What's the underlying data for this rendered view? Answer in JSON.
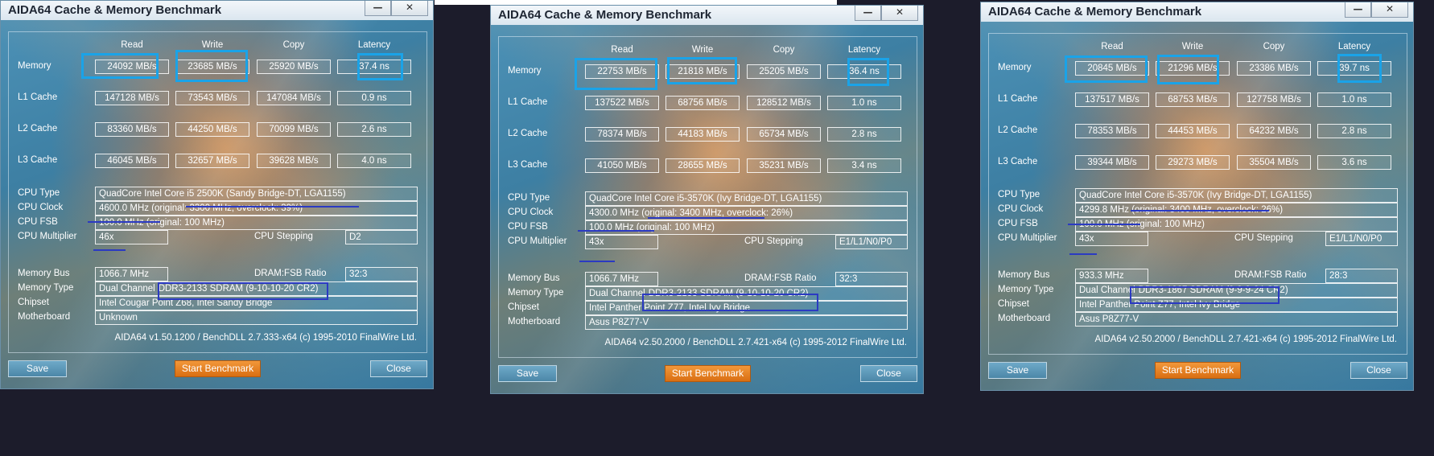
{
  "windows": [
    {
      "title": "AIDA64 Cache & Memory Benchmark",
      "headers": [
        "Read",
        "Write",
        "Copy",
        "Latency"
      ],
      "rows": [
        {
          "label": "Memory",
          "read": "24092 MB/s",
          "write": "23685 MB/s",
          "copy": "25920 MB/s",
          "latency": "37.4 ns"
        },
        {
          "label": "L1 Cache",
          "read": "147128 MB/s",
          "write": "73543 MB/s",
          "copy": "147084 MB/s",
          "latency": "0.9 ns"
        },
        {
          "label": "L2 Cache",
          "read": "83360 MB/s",
          "write": "44250 MB/s",
          "copy": "70099 MB/s",
          "latency": "2.6 ns"
        },
        {
          "label": "L3 Cache",
          "read": "46045 MB/s",
          "write": "32657 MB/s",
          "copy": "39628 MB/s",
          "latency": "4.0 ns"
        }
      ],
      "info": {
        "cpu_type_label": "CPU Type",
        "cpu_type": "QuadCore Intel Core i5 2500K  (Sandy Bridge-DT, LGA1155)",
        "cpu_clock_label": "CPU Clock",
        "cpu_clock": "4600.0 MHz  (original: 3300 MHz, overclock: 39%)",
        "cpu_fsb_label": "CPU FSB",
        "cpu_fsb": "100.0 MHz  (original: 100 MHz)",
        "cpu_mult_label": "CPU Multiplier",
        "cpu_mult": "46x",
        "cpu_step_label": "CPU Stepping",
        "cpu_step": "D2",
        "mem_bus_label": "Memory Bus",
        "mem_bus": "1066.7 MHz",
        "dram_label": "DRAM:FSB Ratio",
        "dram": "32:3",
        "mem_type_label": "Memory Type",
        "mem_type_a": "Dual Channel",
        "mem_type_b": "DDR3-2133 SDRAM  (9-10-10-20 CR2)",
        "chipset_label": "Chipset",
        "chipset": "Intel Cougar Point Z68, Intel Sandy Bridge",
        "mobo_label": "Motherboard",
        "mobo": "Unknown"
      },
      "footer": "AIDA64 v1.50.1200 / BenchDLL 2.7.333-x64  (c) 1995-2010 FinalWire Ltd.",
      "buttons": {
        "save": "Save",
        "start": "Start Benchmark",
        "close": "Close"
      }
    },
    {
      "title": "AIDA64 Cache & Memory Benchmark",
      "headers": [
        "Read",
        "Write",
        "Copy",
        "Latency"
      ],
      "rows": [
        {
          "label": "Memory",
          "read": "22753 MB/s",
          "write": "21818 MB/s",
          "copy": "25205 MB/s",
          "latency": "36.4 ns"
        },
        {
          "label": "L1 Cache",
          "read": "137522 MB/s",
          "write": "68756 MB/s",
          "copy": "128512 MB/s",
          "latency": "1.0 ns"
        },
        {
          "label": "L2 Cache",
          "read": "78374 MB/s",
          "write": "44183 MB/s",
          "copy": "65734 MB/s",
          "latency": "2.8 ns"
        },
        {
          "label": "L3 Cache",
          "read": "41050 MB/s",
          "write": "28655 MB/s",
          "copy": "35231 MB/s",
          "latency": "3.4 ns"
        }
      ],
      "info": {
        "cpu_type_label": "CPU Type",
        "cpu_type": "QuadCore Intel Core i5-3570K  (Ivy Bridge-DT, LGA1155)",
        "cpu_clock_label": "CPU Clock",
        "cpu_clock": "4300.0 MHz  (original: 3400 MHz, overclock: 26%)",
        "cpu_fsb_label": "CPU FSB",
        "cpu_fsb": "100.0 MHz  (original: 100 MHz)",
        "cpu_mult_label": "CPU Multiplier",
        "cpu_mult": "43x",
        "cpu_step_label": "CPU Stepping",
        "cpu_step": "E1/L1/N0/P0",
        "mem_bus_label": "Memory Bus",
        "mem_bus": "1066.7 MHz",
        "dram_label": "DRAM:FSB Ratio",
        "dram": "32:3",
        "mem_type_label": "Memory Type",
        "mem_type_a": "Dual Channel",
        "mem_type_b": "DDR3-2133 SDRAM  (9-10-10-20 CR2)",
        "chipset_label": "Chipset",
        "chipset": "Intel Panther Point Z77, Intel Ivy Bridge",
        "mobo_label": "Motherboard",
        "mobo": "Asus P8Z77-V"
      },
      "footer": "AIDA64 v2.50.2000 / BenchDLL 2.7.421-x64  (c) 1995-2012 FinalWire Ltd.",
      "buttons": {
        "save": "Save",
        "start": "Start Benchmark",
        "close": "Close"
      }
    },
    {
      "title": "AIDA64 Cache & Memory Benchmark",
      "headers": [
        "Read",
        "Write",
        "Copy",
        "Latency"
      ],
      "rows": [
        {
          "label": "Memory",
          "read": "20845 MB/s",
          "write": "21296 MB/s",
          "copy": "23386 MB/s",
          "latency": "39.7 ns"
        },
        {
          "label": "L1 Cache",
          "read": "137517 MB/s",
          "write": "68753 MB/s",
          "copy": "127758 MB/s",
          "latency": "1.0 ns"
        },
        {
          "label": "L2 Cache",
          "read": "78353 MB/s",
          "write": "44453 MB/s",
          "copy": "64232 MB/s",
          "latency": "2.8 ns"
        },
        {
          "label": "L3 Cache",
          "read": "39344 MB/s",
          "write": "29273 MB/s",
          "copy": "35504 MB/s",
          "latency": "3.6 ns"
        }
      ],
      "info": {
        "cpu_type_label": "CPU Type",
        "cpu_type": "QuadCore Intel Core i5-3570K  (Ivy Bridge-DT, LGA1155)",
        "cpu_clock_label": "CPU Clock",
        "cpu_clock": "4299.8 MHz  (original: 3400 MHz, overclock: 26%)",
        "cpu_fsb_label": "CPU FSB",
        "cpu_fsb": "100.0 MHz  (original: 100 MHz)",
        "cpu_mult_label": "CPU Multiplier",
        "cpu_mult": "43x",
        "cpu_step_label": "CPU Stepping",
        "cpu_step": "E1/L1/N0/P0",
        "mem_bus_label": "Memory Bus",
        "mem_bus": "933.3 MHz",
        "dram_label": "DRAM:FSB Ratio",
        "dram": "28:3",
        "mem_type_label": "Memory Type",
        "mem_type_a": "Dual Channel",
        "mem_type_b": "DDR3-1867 SDRAM  (9-9-9-24 CR2)",
        "chipset_label": "Chipset",
        "chipset": "Intel Panther Point Z77, Intel Ivy Bridge",
        "mobo_label": "Motherboard",
        "mobo": "Asus P8Z77-V"
      },
      "footer": "AIDA64 v2.50.2000 / BenchDLL 2.7.421-x64  (c) 1995-2012 FinalWire Ltd.",
      "buttons": {
        "save": "Save",
        "start": "Start Benchmark",
        "close": "Close"
      }
    }
  ],
  "colors": {
    "highlight_box": "#1aa3e8",
    "underline": "#2b3ac2",
    "start_button": "#e07b1e"
  }
}
